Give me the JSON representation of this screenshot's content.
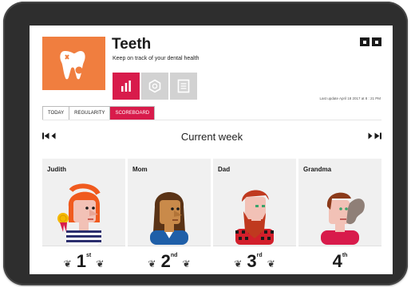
{
  "app": {
    "title": "Teeth",
    "subtitle": "Keep on track of your dental health",
    "last_update": "Last update April 18 2017 at 8 : 21 PM"
  },
  "tabs": [
    {
      "label": "TODAY",
      "active": false
    },
    {
      "label": "REGULARITY",
      "active": false
    },
    {
      "label": "SCOREBOARD",
      "active": true
    }
  ],
  "week": {
    "title": "Current week"
  },
  "players": [
    {
      "name": "Judith",
      "rank": "1",
      "suffix": "st",
      "medal": true
    },
    {
      "name": "Mom",
      "rank": "2",
      "suffix": "nd",
      "medal": false
    },
    {
      "name": "Dad",
      "rank": "3",
      "suffix": "rd",
      "medal": false
    },
    {
      "name": "Grandma",
      "rank": "4",
      "suffix": "th",
      "medal": false
    }
  ],
  "colors": {
    "accent": "#d81b4b",
    "app_icon_bg": "#f07e3f",
    "frame": "#2e2e2e",
    "card_bg": "#f0f0f0"
  },
  "icons": {
    "app": "tooth-icon",
    "view_chart": "bar-chart-icon",
    "view_settings": "gear-icon",
    "view_list": "document-icon"
  }
}
